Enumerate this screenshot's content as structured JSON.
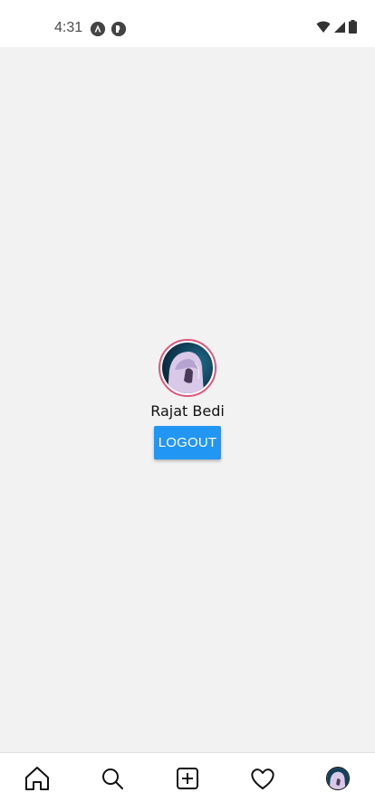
{
  "status_bar": {
    "time": "4:31",
    "left_icons": [
      "app-notification-icon",
      "app-notification-icon"
    ],
    "right_icons": [
      "wifi-icon",
      "signal-icon",
      "battery-icon"
    ]
  },
  "profile": {
    "name": "Rajat Bedi",
    "avatar": "profile-photo",
    "avatar_ring_color": "#e0567c",
    "logout_label": "LOGOUT",
    "logout_color": "#2196f3"
  },
  "bottom_nav": {
    "items": [
      {
        "icon": "home-icon"
      },
      {
        "icon": "search-icon"
      },
      {
        "icon": "add-post-icon"
      },
      {
        "icon": "heart-icon"
      },
      {
        "icon": "profile-avatar"
      }
    ]
  }
}
